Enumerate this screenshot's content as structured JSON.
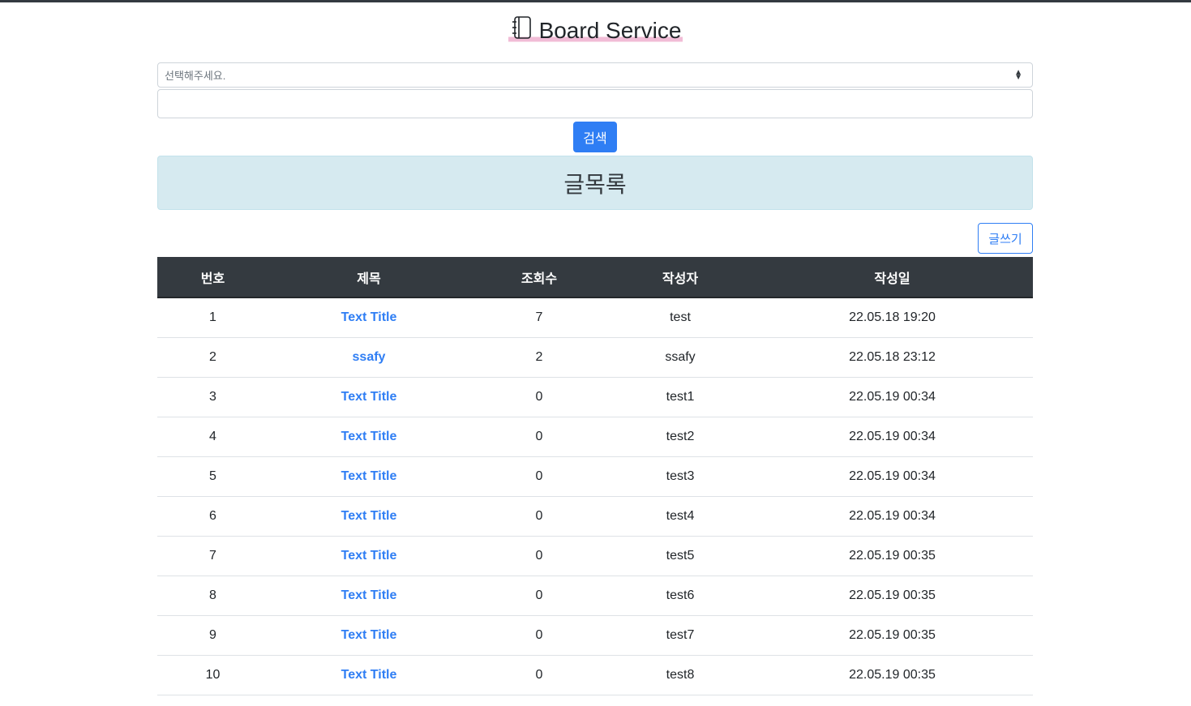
{
  "header": {
    "title": "Board Service",
    "icon": "notebook-icon"
  },
  "search": {
    "select_placeholder": "선택해주세요.",
    "input_value": "",
    "button_label": "검색"
  },
  "banner": {
    "title": "글목록"
  },
  "write_button_label": "글쓰기",
  "table": {
    "columns": [
      "번호",
      "제목",
      "조회수",
      "작성자",
      "작성일"
    ],
    "rows": [
      {
        "no": "1",
        "title": "Text Title",
        "views": "7",
        "author": "test",
        "date": "22.05.18 19:20"
      },
      {
        "no": "2",
        "title": "ssafy",
        "views": "2",
        "author": "ssafy",
        "date": "22.05.18 23:12"
      },
      {
        "no": "3",
        "title": "Text Title",
        "views": "0",
        "author": "test1",
        "date": "22.05.19 00:34"
      },
      {
        "no": "4",
        "title": "Text Title",
        "views": "0",
        "author": "test2",
        "date": "22.05.19 00:34"
      },
      {
        "no": "5",
        "title": "Text Title",
        "views": "0",
        "author": "test3",
        "date": "22.05.19 00:34"
      },
      {
        "no": "6",
        "title": "Text Title",
        "views": "0",
        "author": "test4",
        "date": "22.05.19 00:34"
      },
      {
        "no": "7",
        "title": "Text Title",
        "views": "0",
        "author": "test5",
        "date": "22.05.19 00:35"
      },
      {
        "no": "8",
        "title": "Text Title",
        "views": "0",
        "author": "test6",
        "date": "22.05.19 00:35"
      },
      {
        "no": "9",
        "title": "Text Title",
        "views": "0",
        "author": "test7",
        "date": "22.05.19 00:35"
      },
      {
        "no": "10",
        "title": "Text Title",
        "views": "0",
        "author": "test8",
        "date": "22.05.19 00:35"
      }
    ]
  },
  "colors": {
    "primary": "#2f7ef4",
    "header_dark": "#343a40",
    "banner_bg": "#d6eaf0",
    "title_highlight": "#f1bcd6"
  }
}
